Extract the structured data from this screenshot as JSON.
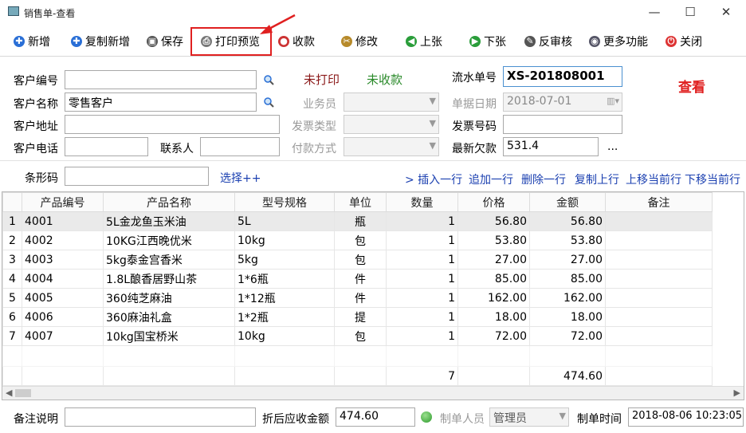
{
  "window": {
    "title": "销售单-查看",
    "min": "—",
    "max": "☐",
    "close": "✕"
  },
  "toolbar": [
    {
      "label": "新增",
      "icon": "plus-icon",
      "color": "#2a6fd6",
      "glyph": "✚"
    },
    {
      "label": "复制新增",
      "icon": "plus-icon",
      "color": "#2a6fd6",
      "glyph": "✚"
    },
    {
      "label": "保存",
      "icon": "save-icon",
      "color": "#555",
      "glyph": "▣"
    },
    {
      "label": "打印预览",
      "icon": "printer-icon",
      "color": "#777",
      "glyph": "⎙"
    },
    {
      "label": "收款",
      "icon": "coins-icon",
      "color": "#c33",
      "glyph": "●"
    },
    {
      "label": "修改",
      "icon": "tools-icon",
      "color": "#b78a2a",
      "glyph": "✂"
    },
    {
      "label": "上张",
      "icon": "arrow-up-icon",
      "color": "#2a9d3a",
      "glyph": "◀"
    },
    {
      "label": "下张",
      "icon": "arrow-down-icon",
      "color": "#2a9d3a",
      "glyph": "▶"
    },
    {
      "label": "反审核",
      "icon": "edit-icon",
      "color": "#555",
      "glyph": "✎"
    },
    {
      "label": "更多功能",
      "icon": "more-icon",
      "color": "#556",
      "glyph": "◉"
    },
    {
      "label": "关闭",
      "icon": "close-icon",
      "color": "#d33",
      "glyph": "⏻"
    }
  ],
  "form": {
    "customer_no_label": "客户编号",
    "customer_no": "",
    "customer_name_label": "客户名称",
    "customer_name": "零售客户",
    "customer_addr_label": "客户地址",
    "customer_addr": "",
    "customer_phone_label": "客户电话",
    "customer_phone": "",
    "contact_label": "联系人",
    "contact": "",
    "print_status": "未打印",
    "pay_status": "未收款",
    "salesman_label": "业务员",
    "invoice_type_label": "发票类型",
    "payment_label": "付款方式",
    "serial_label": "流水单号",
    "serial": "XS-201808001",
    "view_mode": "查看",
    "date_label": "单据日期",
    "date": "2018-07-01",
    "invoice_no_label": "发票号码",
    "invoice_no": "",
    "debt_label": "最新欠款",
    "debt": "531.4",
    "ellipsis": "...",
    "barcode_label": "条形码",
    "barcode": "",
    "select_more": "选择++"
  },
  "row_actions": [
    "> 插入一行",
    "追加一行",
    "删除一行",
    "复制上行",
    "上移当前行",
    "下移当前行"
  ],
  "grid": {
    "columns": [
      "",
      "产品编号",
      "产品名称",
      "型号规格",
      "单位",
      "数量",
      "价格",
      "金额",
      "备注"
    ],
    "rows": [
      [
        "1",
        "4001",
        "5L金龙鱼玉米油",
        "5L",
        "瓶",
        "1",
        "56.80",
        "56.80",
        ""
      ],
      [
        "2",
        "4002",
        "10KG江西晚优米",
        "10kg",
        "包",
        "1",
        "53.80",
        "53.80",
        ""
      ],
      [
        "3",
        "4003",
        "5kg泰金宫香米",
        "5kg",
        "包",
        "1",
        "27.00",
        "27.00",
        ""
      ],
      [
        "4",
        "4004",
        "1.8L酿香居野山茶",
        "1*6瓶",
        "件",
        "1",
        "85.00",
        "85.00",
        ""
      ],
      [
        "5",
        "4005",
        "360纯芝麻油",
        "1*12瓶",
        "件",
        "1",
        "162.00",
        "162.00",
        ""
      ],
      [
        "6",
        "4006",
        "360麻油礼盒",
        "1*2瓶",
        "提",
        "1",
        "18.00",
        "18.00",
        ""
      ],
      [
        "7",
        "4007",
        "10kg国宝桥米",
        "10kg",
        "包",
        "1",
        "72.00",
        "72.00",
        ""
      ]
    ],
    "total_qty": "7",
    "total_amount": "474.60"
  },
  "footer": {
    "remark_label": "备注说明",
    "remark": "",
    "receivable_label": "折后应收金额",
    "receivable": "474.60",
    "maker_label": "制单人员",
    "maker": "管理员",
    "time_label": "制单时间",
    "time": "2018-08-06 10:23:05"
  }
}
